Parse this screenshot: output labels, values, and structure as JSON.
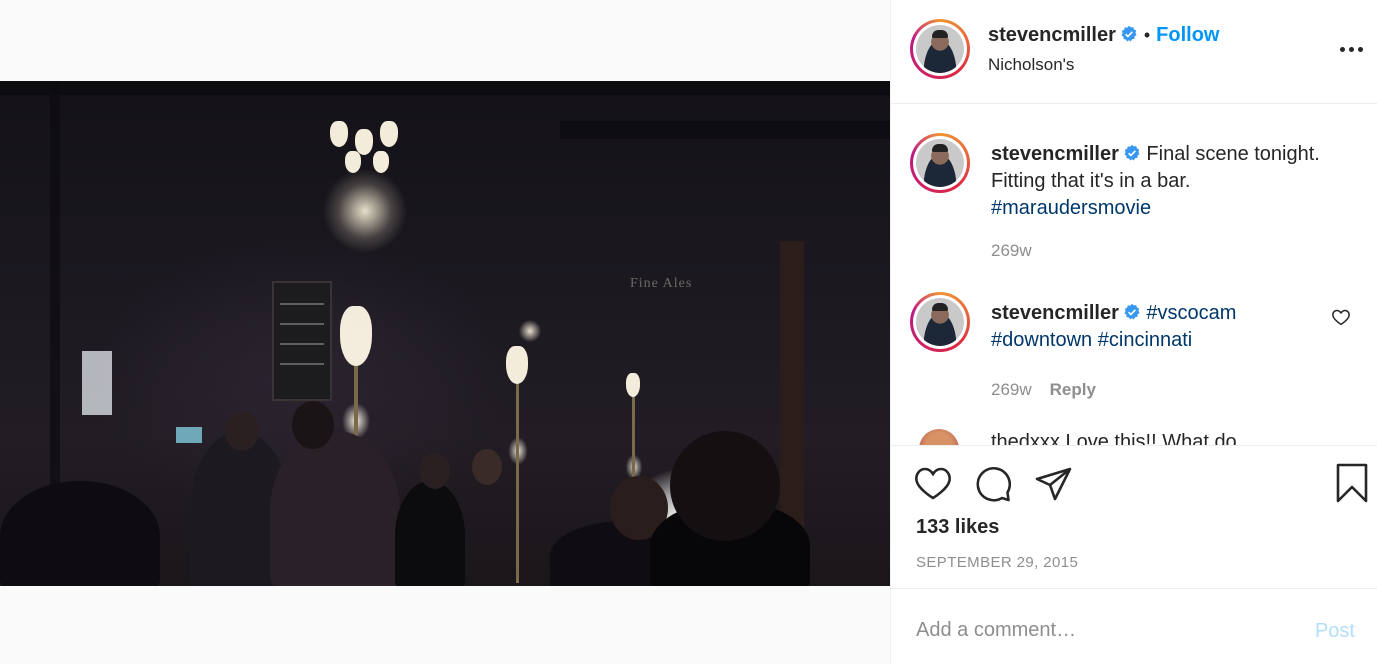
{
  "post": {
    "author": "stevencmiller",
    "follow_label": "Follow",
    "separator": "•",
    "location": "Nicholson's",
    "photo_sign": "Fine Ales"
  },
  "comments": [
    {
      "username": "stevencmiller",
      "text": "Final scene tonight. Fitting that it's in a bar.",
      "hashtags": "#maraudersmovie",
      "time": "269w"
    },
    {
      "username": "stevencmiller",
      "hashtag_1": "#vscocam",
      "hashtag_2": "#downtown",
      "hashtag_3": "#cincinnati",
      "time": "269w",
      "reply_label": "Reply"
    }
  ],
  "partial_comment": "thedxxx   Love this!! What do",
  "engagement": {
    "likes": "133 likes",
    "date": "SEPTEMBER 29, 2015"
  },
  "comment_box": {
    "placeholder": "Add a comment…",
    "post_label": "Post"
  },
  "colors": {
    "accent": "#0095f6",
    "hashtag": "#00376b",
    "muted": "#8e8e8e",
    "post_disabled": "#b2dffc"
  },
  "icons": {
    "verified": "verified-badge-icon",
    "more": "more-options-icon",
    "like": "heart-icon",
    "comment": "comment-bubble-icon",
    "share": "paper-plane-icon",
    "save": "bookmark-icon"
  }
}
